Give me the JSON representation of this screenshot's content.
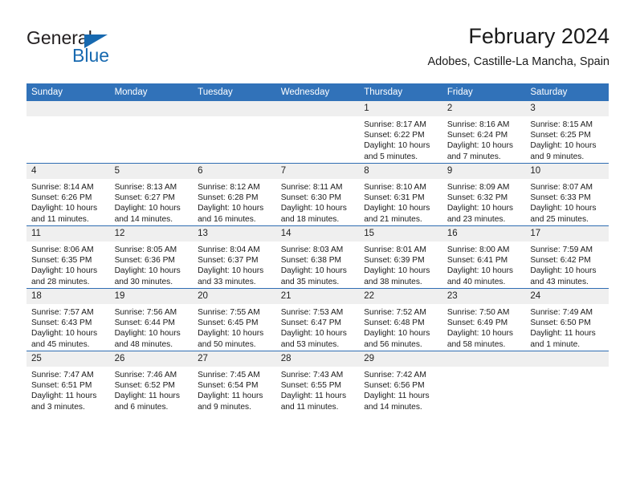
{
  "brand": {
    "name_top": "General",
    "name_bottom": "Blue",
    "accent_color": "#1769b0"
  },
  "header": {
    "title": "February 2024",
    "subtitle": "Adobes, Castille-La Mancha, Spain"
  },
  "calendar": {
    "header_bg": "#3172b9",
    "header_text_color": "#ffffff",
    "daynum_bg": "#efefef",
    "row_divider_color": "#2f6db3",
    "weekdays": [
      "Sunday",
      "Monday",
      "Tuesday",
      "Wednesday",
      "Thursday",
      "Friday",
      "Saturday"
    ],
    "weeks": [
      [
        {
          "day": "",
          "blank": true
        },
        {
          "day": "",
          "blank": true
        },
        {
          "day": "",
          "blank": true
        },
        {
          "day": "",
          "blank": true
        },
        {
          "day": "1",
          "sunrise": "Sunrise: 8:17 AM",
          "sunset": "Sunset: 6:22 PM",
          "daylight": "Daylight: 10 hours and 5 minutes."
        },
        {
          "day": "2",
          "sunrise": "Sunrise: 8:16 AM",
          "sunset": "Sunset: 6:24 PM",
          "daylight": "Daylight: 10 hours and 7 minutes."
        },
        {
          "day": "3",
          "sunrise": "Sunrise: 8:15 AM",
          "sunset": "Sunset: 6:25 PM",
          "daylight": "Daylight: 10 hours and 9 minutes."
        }
      ],
      [
        {
          "day": "4",
          "sunrise": "Sunrise: 8:14 AM",
          "sunset": "Sunset: 6:26 PM",
          "daylight": "Daylight: 10 hours and 11 minutes."
        },
        {
          "day": "5",
          "sunrise": "Sunrise: 8:13 AM",
          "sunset": "Sunset: 6:27 PM",
          "daylight": "Daylight: 10 hours and 14 minutes."
        },
        {
          "day": "6",
          "sunrise": "Sunrise: 8:12 AM",
          "sunset": "Sunset: 6:28 PM",
          "daylight": "Daylight: 10 hours and 16 minutes."
        },
        {
          "day": "7",
          "sunrise": "Sunrise: 8:11 AM",
          "sunset": "Sunset: 6:30 PM",
          "daylight": "Daylight: 10 hours and 18 minutes."
        },
        {
          "day": "8",
          "sunrise": "Sunrise: 8:10 AM",
          "sunset": "Sunset: 6:31 PM",
          "daylight": "Daylight: 10 hours and 21 minutes."
        },
        {
          "day": "9",
          "sunrise": "Sunrise: 8:09 AM",
          "sunset": "Sunset: 6:32 PM",
          "daylight": "Daylight: 10 hours and 23 minutes."
        },
        {
          "day": "10",
          "sunrise": "Sunrise: 8:07 AM",
          "sunset": "Sunset: 6:33 PM",
          "daylight": "Daylight: 10 hours and 25 minutes."
        }
      ],
      [
        {
          "day": "11",
          "sunrise": "Sunrise: 8:06 AM",
          "sunset": "Sunset: 6:35 PM",
          "daylight": "Daylight: 10 hours and 28 minutes."
        },
        {
          "day": "12",
          "sunrise": "Sunrise: 8:05 AM",
          "sunset": "Sunset: 6:36 PM",
          "daylight": "Daylight: 10 hours and 30 minutes."
        },
        {
          "day": "13",
          "sunrise": "Sunrise: 8:04 AM",
          "sunset": "Sunset: 6:37 PM",
          "daylight": "Daylight: 10 hours and 33 minutes."
        },
        {
          "day": "14",
          "sunrise": "Sunrise: 8:03 AM",
          "sunset": "Sunset: 6:38 PM",
          "daylight": "Daylight: 10 hours and 35 minutes."
        },
        {
          "day": "15",
          "sunrise": "Sunrise: 8:01 AM",
          "sunset": "Sunset: 6:39 PM",
          "daylight": "Daylight: 10 hours and 38 minutes."
        },
        {
          "day": "16",
          "sunrise": "Sunrise: 8:00 AM",
          "sunset": "Sunset: 6:41 PM",
          "daylight": "Daylight: 10 hours and 40 minutes."
        },
        {
          "day": "17",
          "sunrise": "Sunrise: 7:59 AM",
          "sunset": "Sunset: 6:42 PM",
          "daylight": "Daylight: 10 hours and 43 minutes."
        }
      ],
      [
        {
          "day": "18",
          "sunrise": "Sunrise: 7:57 AM",
          "sunset": "Sunset: 6:43 PM",
          "daylight": "Daylight: 10 hours and 45 minutes."
        },
        {
          "day": "19",
          "sunrise": "Sunrise: 7:56 AM",
          "sunset": "Sunset: 6:44 PM",
          "daylight": "Daylight: 10 hours and 48 minutes."
        },
        {
          "day": "20",
          "sunrise": "Sunrise: 7:55 AM",
          "sunset": "Sunset: 6:45 PM",
          "daylight": "Daylight: 10 hours and 50 minutes."
        },
        {
          "day": "21",
          "sunrise": "Sunrise: 7:53 AM",
          "sunset": "Sunset: 6:47 PM",
          "daylight": "Daylight: 10 hours and 53 minutes."
        },
        {
          "day": "22",
          "sunrise": "Sunrise: 7:52 AM",
          "sunset": "Sunset: 6:48 PM",
          "daylight": "Daylight: 10 hours and 56 minutes."
        },
        {
          "day": "23",
          "sunrise": "Sunrise: 7:50 AM",
          "sunset": "Sunset: 6:49 PM",
          "daylight": "Daylight: 10 hours and 58 minutes."
        },
        {
          "day": "24",
          "sunrise": "Sunrise: 7:49 AM",
          "sunset": "Sunset: 6:50 PM",
          "daylight": "Daylight: 11 hours and 1 minute."
        }
      ],
      [
        {
          "day": "25",
          "sunrise": "Sunrise: 7:47 AM",
          "sunset": "Sunset: 6:51 PM",
          "daylight": "Daylight: 11 hours and 3 minutes."
        },
        {
          "day": "26",
          "sunrise": "Sunrise: 7:46 AM",
          "sunset": "Sunset: 6:52 PM",
          "daylight": "Daylight: 11 hours and 6 minutes."
        },
        {
          "day": "27",
          "sunrise": "Sunrise: 7:45 AM",
          "sunset": "Sunset: 6:54 PM",
          "daylight": "Daylight: 11 hours and 9 minutes."
        },
        {
          "day": "28",
          "sunrise": "Sunrise: 7:43 AM",
          "sunset": "Sunset: 6:55 PM",
          "daylight": "Daylight: 11 hours and 11 minutes."
        },
        {
          "day": "29",
          "sunrise": "Sunrise: 7:42 AM",
          "sunset": "Sunset: 6:56 PM",
          "daylight": "Daylight: 11 hours and 14 minutes."
        },
        {
          "day": "",
          "blank": true
        },
        {
          "day": "",
          "blank": true
        }
      ]
    ]
  }
}
